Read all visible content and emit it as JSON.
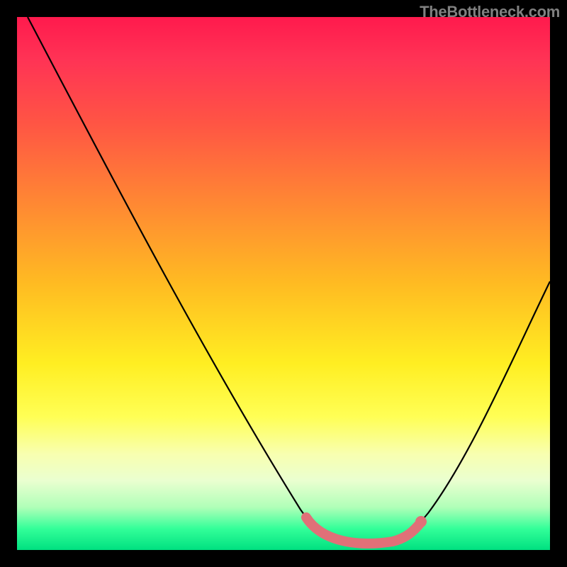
{
  "watermark": "TheBottleneck.com",
  "chart_data": {
    "type": "line",
    "title": "",
    "xlabel": "",
    "ylabel": "",
    "ylim": [
      0,
      100
    ],
    "xlim": [
      0,
      100
    ],
    "series": [
      {
        "name": "bottleneck-curve",
        "x": [
          0,
          5,
          10,
          15,
          20,
          25,
          30,
          35,
          40,
          45,
          50,
          55,
          60,
          65,
          68,
          70,
          75,
          80,
          85,
          90,
          95,
          100
        ],
        "values": [
          100,
          92,
          84,
          76,
          68,
          60,
          52,
          44,
          36,
          28,
          20,
          12,
          5,
          1,
          0,
          0,
          1,
          5,
          14,
          26,
          40,
          55
        ]
      }
    ],
    "highlight": {
      "name": "optimal-range",
      "x_start": 55,
      "x_end": 76,
      "color": "#e07078"
    },
    "background_gradient": {
      "top": "#ff1a4d",
      "mid": "#ffee22",
      "bottom": "#00e080"
    }
  }
}
